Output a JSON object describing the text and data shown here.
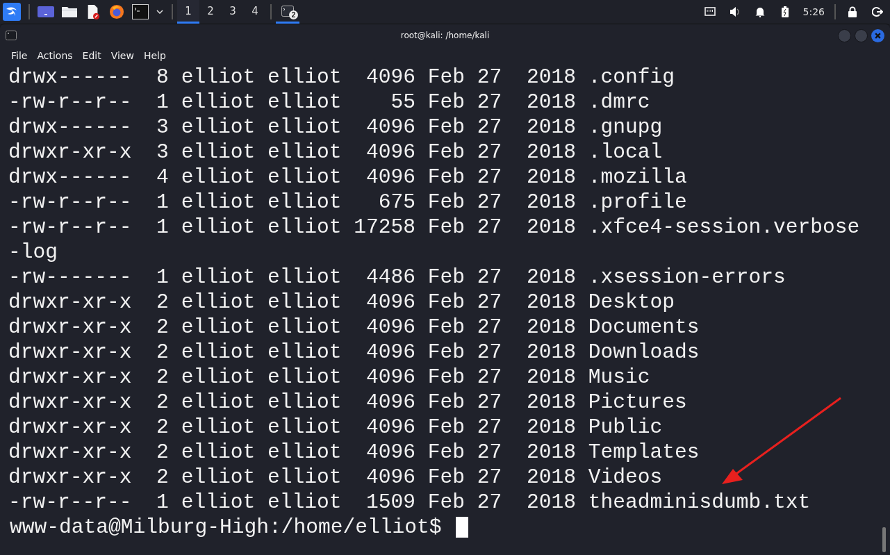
{
  "taskbar": {
    "launchers": [
      {
        "kind": "kali"
      },
      {
        "kind": "workspace"
      },
      {
        "kind": "files"
      },
      {
        "kind": "editor"
      },
      {
        "kind": "firefox"
      },
      {
        "kind": "terminal"
      },
      {
        "kind": "caret"
      }
    ],
    "workspaces": [
      {
        "label": "1",
        "selected": true
      },
      {
        "label": "2",
        "selected": false
      },
      {
        "label": "3",
        "selected": false
      },
      {
        "label": "4",
        "selected": false
      }
    ],
    "task": {
      "badge": "2",
      "selected": true
    },
    "tray": [
      {
        "kind": "network"
      },
      {
        "kind": "volume"
      },
      {
        "kind": "bell"
      },
      {
        "kind": "battery"
      }
    ],
    "clock": "5:26"
  },
  "window": {
    "title": "root@kali: /home/kali",
    "menu": [
      "File",
      "Actions",
      "Edit",
      "View",
      "Help"
    ]
  },
  "terminal": {
    "lines": [
      "drwx------  8 elliot elliot  4096 Feb 27  2018 .config",
      "-rw-r--r--  1 elliot elliot    55 Feb 27  2018 .dmrc",
      "drwx------  3 elliot elliot  4096 Feb 27  2018 .gnupg",
      "drwxr-xr-x  3 elliot elliot  4096 Feb 27  2018 .local",
      "drwx------  4 elliot elliot  4096 Feb 27  2018 .mozilla",
      "-rw-r--r--  1 elliot elliot   675 Feb 27  2018 .profile",
      "-rw-r--r--  1 elliot elliot 17258 Feb 27  2018 .xfce4-session.verbose-log",
      "-rw-------  1 elliot elliot  4486 Feb 27  2018 .xsession-errors",
      "drwxr-xr-x  2 elliot elliot  4096 Feb 27  2018 Desktop",
      "drwxr-xr-x  2 elliot elliot  4096 Feb 27  2018 Documents",
      "drwxr-xr-x  2 elliot elliot  4096 Feb 27  2018 Downloads",
      "drwxr-xr-x  2 elliot elliot  4096 Feb 27  2018 Music",
      "drwxr-xr-x  2 elliot elliot  4096 Feb 27  2018 Pictures",
      "drwxr-xr-x  2 elliot elliot  4096 Feb 27  2018 Public",
      "drwxr-xr-x  2 elliot elliot  4096 Feb 27  2018 Templates",
      "drwxr-xr-x  2 elliot elliot  4096 Feb 27  2018 Videos",
      "-rw-r--r--  1 elliot elliot  1509 Feb 27  2018 theadminisdumb.txt"
    ],
    "prompt": "www-data@Milburg-High:/home/elliot$"
  }
}
